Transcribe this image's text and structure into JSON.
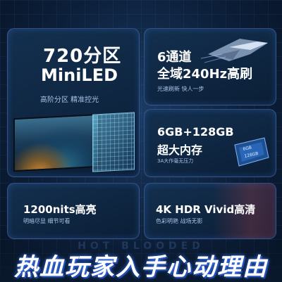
{
  "cards": {
    "miniled": {
      "title_line1": "720分区",
      "title_line2": "MiniLED",
      "subtitle": "高阶分区  精准控光"
    },
    "refresh": {
      "title_line1": "6通道",
      "title_line2": "全域240Hz高刷",
      "subtitle": "光速刷新 快人一步"
    },
    "storage": {
      "title_line1": "6GB+128GB",
      "title_line2": "超大内存",
      "subtitle": "3A大作毫无压力",
      "chip_label_1": "6GB",
      "chip_label_2": "128GB"
    },
    "brightness": {
      "title": "1200nits高亮",
      "subtitle": "明暗尽显 细节可看"
    },
    "hdr": {
      "title": "4K HDR Vivid高清",
      "subtitle": "色彩明艳 战场无影"
    }
  },
  "banner": {
    "title": "热血玩家入手心动理由",
    "ghost_text": "HOT BLOODED"
  },
  "colors": {
    "accent": "#3a7bff",
    "background": "#0a1a2e",
    "subtitle": "#a9c3e6"
  }
}
